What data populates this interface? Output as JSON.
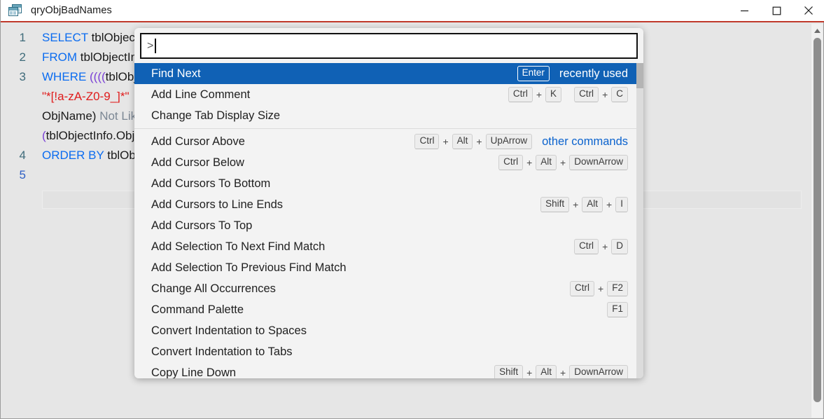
{
  "window": {
    "title": "qryObjBadNames",
    "icon": "access-query-icon",
    "minimize_label": "Minimize",
    "maximize_label": "Maximize",
    "close_label": "Close"
  },
  "editor": {
    "line_numbers": [
      "1",
      "2",
      "3",
      "",
      "",
      "",
      "4",
      "5"
    ],
    "current_line": "5",
    "lines": [
      {
        "segments": [
          {
            "text": "SELECT ",
            "cls": "kw"
          },
          {
            "text": "tblObjectInfo.ObjName",
            "cls": "ident"
          }
        ]
      },
      {
        "segments": [
          {
            "text": "FROM ",
            "cls": "kw"
          },
          {
            "text": "tblObjectInfo",
            "cls": "ident"
          }
        ]
      },
      {
        "segments": [
          {
            "text": "WHERE ",
            "cls": "kw"
          },
          {
            "text": "((((",
            "cls": "op"
          },
          {
            "text": "tblObjectInfo.ObjName) Like ",
            "cls": "ident"
          }
        ]
      },
      {
        "segments": [
          {
            "text": "\"*[!a-zA-Z0-9_]*\"",
            "cls": "str"
          }
        ]
      },
      {
        "segments": [
          {
            "text": "ObjName) ",
            "cls": "ident"
          },
          {
            "text": "Not Like",
            "cls": "dim"
          }
        ]
      },
      {
        "segments": [
          {
            "text": "(",
            "cls": "op"
          },
          {
            "text": "tblObjectInfo.ObjType",
            "cls": "ident"
          }
        ]
      },
      {
        "segments": [
          {
            "text": "ORDER BY ",
            "cls": "kw"
          },
          {
            "text": "tblObjectInfo.ObjName",
            "cls": "ident"
          }
        ]
      },
      {
        "segments": [
          {
            "text": "",
            "cls": "ident"
          }
        ]
      }
    ],
    "scrollbar": {
      "arrow_up": "scroll-up-arrow"
    }
  },
  "palette": {
    "input_prompt": ">",
    "input_value": "",
    "input_placeholder": "",
    "items": [
      {
        "label": "Find Next",
        "keys": [
          "Enter"
        ],
        "tag": "recently used",
        "selected": true,
        "sep_after": false
      },
      {
        "label": "Add Line Comment",
        "keys": [
          "Ctrl",
          "K",
          "Ctrl",
          "C"
        ],
        "groups": [
          2,
          2
        ],
        "tag": "",
        "selected": false,
        "sep_after": false
      },
      {
        "label": "Change Tab Display Size",
        "keys": [],
        "tag": "",
        "selected": false,
        "sep_after": true
      },
      {
        "label": "Add Cursor Above",
        "keys": [
          "Ctrl",
          "Alt",
          "UpArrow"
        ],
        "tag": "other commands",
        "tag_blue": true,
        "selected": false,
        "sep_after": false
      },
      {
        "label": "Add Cursor Below",
        "keys": [
          "Ctrl",
          "Alt",
          "DownArrow"
        ],
        "tag": "",
        "selected": false,
        "sep_after": false
      },
      {
        "label": "Add Cursors To Bottom",
        "keys": [],
        "tag": "",
        "selected": false,
        "sep_after": false
      },
      {
        "label": "Add Cursors to Line Ends",
        "keys": [
          "Shift",
          "Alt",
          "I"
        ],
        "tag": "",
        "selected": false,
        "sep_after": false
      },
      {
        "label": "Add Cursors To Top",
        "keys": [],
        "tag": "",
        "selected": false,
        "sep_after": false
      },
      {
        "label": "Add Selection To Next Find Match",
        "keys": [
          "Ctrl",
          "D"
        ],
        "tag": "",
        "selected": false,
        "sep_after": false
      },
      {
        "label": "Add Selection To Previous Find Match",
        "keys": [],
        "tag": "",
        "selected": false,
        "sep_after": false
      },
      {
        "label": "Change All Occurrences",
        "keys": [
          "Ctrl",
          "F2"
        ],
        "tag": "",
        "selected": false,
        "sep_after": false
      },
      {
        "label": "Command Palette",
        "keys": [
          "F1"
        ],
        "tag": "",
        "selected": false,
        "sep_after": false
      },
      {
        "label": "Convert Indentation to Spaces",
        "keys": [],
        "tag": "",
        "selected": false,
        "sep_after": false
      },
      {
        "label": "Convert Indentation to Tabs",
        "keys": [],
        "tag": "",
        "selected": false,
        "sep_after": false
      },
      {
        "label": "Copy Line Down",
        "keys": [
          "Shift",
          "Alt",
          "DownArrow"
        ],
        "tag": "",
        "selected": false,
        "sep_after": false
      }
    ]
  },
  "colors": {
    "accent_border": "#c0392b",
    "selection_blue": "#1061b5",
    "link_blue": "#0b63ce",
    "keyword_blue": "#0b6cf0",
    "string_red": "#e01b1b",
    "editor_bg": "#e6e6e6"
  }
}
